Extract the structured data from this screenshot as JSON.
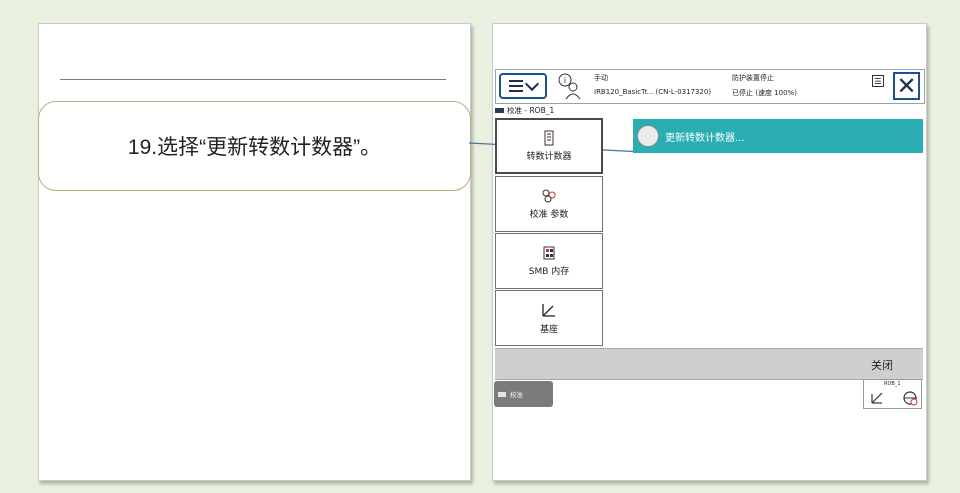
{
  "instruction": "19.选择“更新转数计数器”。",
  "status": {
    "mode": "手动",
    "system": "IRB120_BasicTr...  (CN-L-0317320)",
    "state": "防护装置停止",
    "speed": "已停止 (速度 100%)"
  },
  "breadcrumb": "校准 - ROB_1",
  "sidebar": {
    "items": [
      {
        "label": "转数计数器",
        "icon": "rev-counter-icon"
      },
      {
        "label": "校准 参数",
        "icon": "calibration-params-icon"
      },
      {
        "label": "SMB 内存",
        "icon": "smb-memory-icon"
      },
      {
        "label": "基座",
        "icon": "base-frame-icon"
      }
    ]
  },
  "list": {
    "item_label": "更新转数计数器..."
  },
  "bottom": {
    "close_label": "关闭"
  },
  "taskbar": {
    "tab_label": "校准",
    "quickset_label": "ROB_1"
  },
  "colors": {
    "accent": "#2aaeb3",
    "frame": "#1f4f8e",
    "background": "#e9f0df"
  }
}
